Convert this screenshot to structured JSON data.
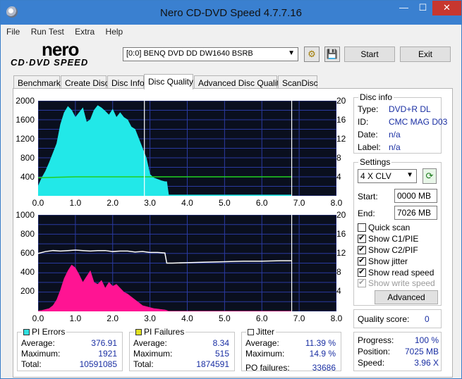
{
  "window": {
    "title": "Nero CD-DVD Speed 4.7.7.16",
    "controls": {
      "minimize": "—",
      "maximize": "☐",
      "close": "✕"
    }
  },
  "menu": [
    "File",
    "Run Test",
    "Extra",
    "Help"
  ],
  "logo": {
    "line1": "nero",
    "line2": "CD·DVD SPEED"
  },
  "toolbar": {
    "drive": "[0:0]   BENQ DVD DD DW1640 BSRB",
    "start": "Start",
    "exit": "Exit"
  },
  "tabs": [
    "Benchmark",
    "Create Disc",
    "Disc Info",
    "Disc Quality",
    "Advanced Disc Quality",
    "ScanDisc"
  ],
  "active_tab": "Disc Quality",
  "disc_info": {
    "heading": "Disc info",
    "type_label": "Type:",
    "type": "DVD+R DL",
    "id_label": "ID:",
    "id": "CMC MAG D03",
    "date_label": "Date:",
    "date": "n/a",
    "label_label": "Label:",
    "label": "n/a"
  },
  "settings": {
    "heading": "Settings",
    "speed": "4 X CLV",
    "start_label": "Start:",
    "start": "0000 MB",
    "end_label": "End:",
    "end": "7026 MB",
    "checks": [
      {
        "label": "Quick scan",
        "checked": false,
        "enabled": true
      },
      {
        "label": "Show C1/PIE",
        "checked": true,
        "enabled": true
      },
      {
        "label": "Show C2/PIF",
        "checked": true,
        "enabled": true
      },
      {
        "label": "Show jitter",
        "checked": true,
        "enabled": true
      },
      {
        "label": "Show read speed",
        "checked": true,
        "enabled": true
      },
      {
        "label": "Show write speed",
        "checked": true,
        "enabled": false
      }
    ],
    "advanced": "Advanced"
  },
  "quality": {
    "label": "Quality score:",
    "value": "0"
  },
  "progress": {
    "progress_label": "Progress:",
    "progress": "100 %",
    "position_label": "Position:",
    "position": "7025 MB",
    "speed_label": "Speed:",
    "speed": "3.96 X"
  },
  "pi_errors": {
    "title": "PI Errors",
    "color": "#2fe0e0",
    "average_label": "Average:",
    "average": "376.91",
    "maximum_label": "Maximum:",
    "maximum": "1921",
    "total_label": "Total:",
    "total": "10591085"
  },
  "pi_failures": {
    "title": "PI Failures",
    "color": "#e0e020",
    "average_label": "Average:",
    "average": "8.34",
    "maximum_label": "Maximum:",
    "maximum": "515",
    "total_label": "Total:",
    "total": "1874591"
  },
  "jitter": {
    "title": "Jitter",
    "color": "#ffffff",
    "average_label": "Average:",
    "average": "11.39 %",
    "maximum_label": "Maximum:",
    "maximum": "14.9 %",
    "po_label": "PO failures:",
    "po": "33686"
  },
  "chart_data": [
    {
      "type": "area",
      "series": [
        {
          "name": "PI Errors",
          "color": "#22e8e8",
          "x": [
            0.0,
            0.1,
            0.2,
            0.3,
            0.4,
            0.5,
            0.6,
            0.7,
            0.8,
            0.9,
            1.0,
            1.1,
            1.2,
            1.3,
            1.4,
            1.5,
            1.6,
            1.7,
            1.8,
            1.9,
            2.0,
            2.1,
            2.2,
            2.3,
            2.4,
            2.5,
            2.6,
            2.7,
            2.8,
            2.9,
            3.0,
            3.1,
            3.2,
            3.3,
            3.4,
            3.45,
            3.5,
            4.0,
            5.0,
            6.0,
            6.8
          ],
          "y": [
            200,
            380,
            520,
            700,
            900,
            1100,
            1500,
            1750,
            1880,
            1800,
            1650,
            1750,
            1850,
            1550,
            1600,
            1800,
            1900,
            1850,
            1780,
            1700,
            1820,
            1650,
            1750,
            1650,
            1600,
            1450,
            1400,
            1200,
            1000,
            800,
            450,
            380,
            350,
            320,
            300,
            300,
            20,
            20,
            20,
            20,
            20
          ]
        },
        {
          "name": "Read Speed",
          "color": "#20d020",
          "x": [
            0.0,
            0.5,
            1.0,
            1.5,
            2.0,
            2.5,
            3.0,
            3.45,
            4.0,
            5.0,
            6.0,
            6.8
          ],
          "y": [
            3.8,
            3.9,
            4.0,
            4.0,
            4.0,
            4.0,
            4.0,
            4.0,
            4.0,
            4.0,
            4.0,
            4.0
          ]
        }
      ],
      "xlim": [
        0,
        8
      ],
      "ylim_left": [
        0,
        2000
      ],
      "ylim_right": [
        0,
        20
      ],
      "xticks": [
        "0.0",
        "1.0",
        "2.0",
        "3.0",
        "4.0",
        "5.0",
        "6.0",
        "7.0",
        "8.0"
      ],
      "yticks_left": [
        "2000",
        "1600",
        "1200",
        "800",
        "400"
      ],
      "yticks_right": [
        "20",
        "16",
        "12",
        "8",
        "4"
      ],
      "markers_x": [
        2.85,
        6.8
      ]
    },
    {
      "type": "area",
      "series": [
        {
          "name": "PI Failures",
          "color": "#ff1493",
          "x": [
            0.0,
            0.1,
            0.2,
            0.3,
            0.4,
            0.5,
            0.6,
            0.7,
            0.8,
            0.9,
            1.0,
            1.1,
            1.2,
            1.3,
            1.4,
            1.5,
            1.6,
            1.7,
            1.8,
            1.9,
            2.0,
            2.1,
            2.2,
            2.3,
            2.4,
            2.5,
            2.6,
            2.7,
            2.8,
            2.9,
            3.0,
            3.1,
            3.2,
            3.3,
            3.4,
            3.45,
            3.5,
            6.8
          ],
          "y": [
            5,
            10,
            20,
            30,
            60,
            120,
            220,
            340,
            420,
            480,
            450,
            380,
            300,
            360,
            420,
            300,
            280,
            320,
            240,
            300,
            260,
            280,
            240,
            200,
            180,
            150,
            120,
            90,
            60,
            50,
            40,
            30,
            25,
            20,
            15,
            10,
            2,
            2
          ]
        },
        {
          "name": "Jitter",
          "color": "#ffffff",
          "x": [
            0.0,
            0.2,
            0.4,
            0.6,
            0.8,
            1.0,
            1.2,
            1.4,
            1.6,
            1.8,
            2.0,
            2.2,
            2.4,
            2.6,
            2.8,
            3.0,
            3.2,
            3.4,
            3.45,
            3.6,
            4.0,
            4.5,
            5.0,
            5.5,
            6.0,
            6.5,
            6.8
          ],
          "y": [
            12.0,
            12.4,
            12.6,
            12.5,
            12.6,
            12.7,
            12.6,
            12.5,
            12.6,
            12.6,
            12.4,
            12.5,
            12.5,
            12.3,
            12.4,
            12.2,
            12.2,
            12.1,
            10.0,
            10.0,
            10.1,
            10.2,
            10.3,
            10.4,
            10.4,
            10.5,
            10.5
          ]
        }
      ],
      "xlim": [
        0,
        8
      ],
      "ylim_left": [
        0,
        1000
      ],
      "ylim_right": [
        0,
        20
      ],
      "xticks": [
        "0.0",
        "1.0",
        "2.0",
        "3.0",
        "4.0",
        "5.0",
        "6.0",
        "7.0",
        "8.0"
      ],
      "yticks_left": [
        "1000",
        "800",
        "600",
        "400",
        "200"
      ],
      "yticks_right": [
        "20",
        "16",
        "12",
        "8",
        "4"
      ],
      "markers_x": [
        6.8
      ]
    }
  ]
}
